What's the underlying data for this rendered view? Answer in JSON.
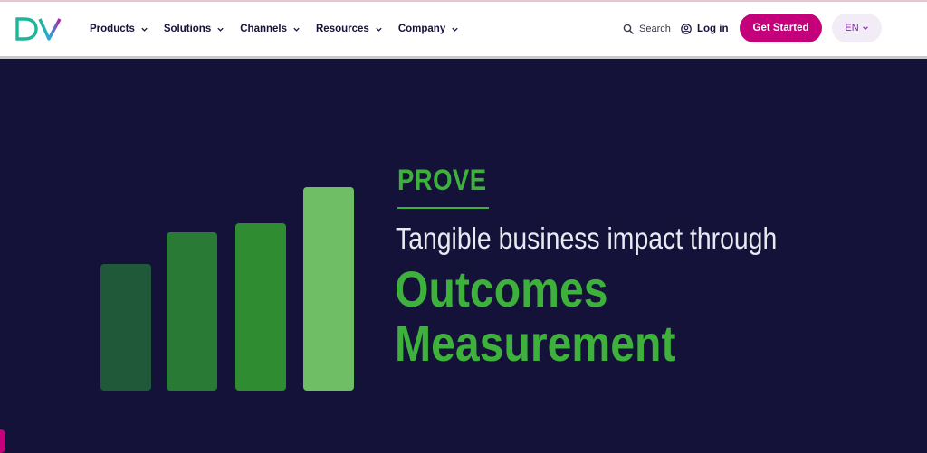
{
  "nav": {
    "logo_icon": "dv-logo-icon",
    "items": [
      {
        "label": "Products"
      },
      {
        "label": "Solutions"
      },
      {
        "label": "Channels"
      },
      {
        "label": "Resources"
      },
      {
        "label": "Company"
      }
    ],
    "search_label": "Search",
    "login_label": "Log in",
    "cta_label": "Get Started",
    "lang_label": "EN"
  },
  "hero": {
    "eyebrow": "PROVE",
    "subhead": "Tangible business impact through",
    "headline_line1": "Outcomes",
    "headline_line2": "Measurement"
  },
  "chart_data": {
    "type": "bar",
    "values": [
      140,
      175,
      185,
      225
    ],
    "colors": [
      "#20593a",
      "#297a35",
      "#2f8c30",
      "#6fbd64"
    ],
    "ylim": [
      0,
      225
    ]
  },
  "colors": {
    "brand_magenta": "#c4007a",
    "brand_green": "#3db13b",
    "hero_bg": "#15123a",
    "nav_text": "#15133a"
  }
}
